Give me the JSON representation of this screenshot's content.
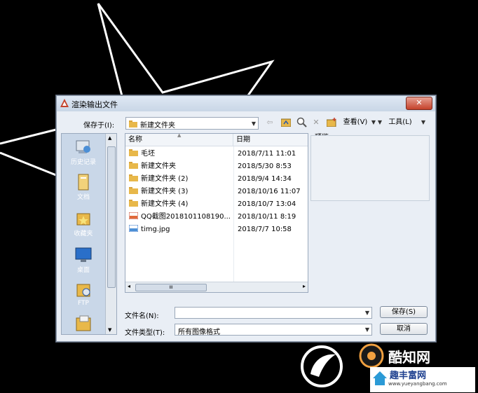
{
  "dialog": {
    "title": "渲染输出文件",
    "close": "✕",
    "save_in_label": "保存于(I):",
    "current_folder": "新建文件夹",
    "view_menu": "查看(V)",
    "tools_menu": "工具(L)",
    "preview_label": "预览"
  },
  "places": [
    {
      "label": "历史记录",
      "icon": "history-icon"
    },
    {
      "label": "文档",
      "icon": "documents-icon"
    },
    {
      "label": "收藏夹",
      "icon": "favorites-icon"
    },
    {
      "label": "桌面",
      "icon": "desktop-icon"
    },
    {
      "label": "FTP",
      "icon": "ftp-icon"
    },
    {
      "label": "",
      "icon": "folder-icon"
    }
  ],
  "filelist": {
    "col_name": "名称",
    "col_date": "日期",
    "rows": [
      {
        "name": "毛坯",
        "date": "2018/7/11 11:01",
        "type": "folder"
      },
      {
        "name": "新建文件夹",
        "date": "2018/5/30 8:53",
        "type": "folder"
      },
      {
        "name": "新建文件夹 (2)",
        "date": "2018/9/4 14:34",
        "type": "folder"
      },
      {
        "name": "新建文件夹 (3)",
        "date": "2018/10/16 11:07",
        "type": "folder"
      },
      {
        "name": "新建文件夹 (4)",
        "date": "2018/10/7 13:04",
        "type": "folder"
      },
      {
        "name": "QQ截图2018101108190...",
        "date": "2018/10/11 8:19",
        "type": "png"
      },
      {
        "name": "timg.jpg",
        "date": "2018/7/7 10:58",
        "type": "jpg"
      }
    ],
    "hscroll_grip": "III"
  },
  "form": {
    "filename_label": "文件名(N):",
    "filename_value": "",
    "filetype_label": "文件类型(T):",
    "filetype_value": "所有图像格式",
    "save_button": "保存(S)",
    "cancel_button": "取消"
  },
  "watermark": {
    "text1": "酷知网",
    "text2": "趣丰富网",
    "url": "www.yueyangbang.com"
  },
  "colors": {
    "folder": "#e8b84a",
    "accent": "#c4422b",
    "places_bg": "#c9d7e8"
  }
}
